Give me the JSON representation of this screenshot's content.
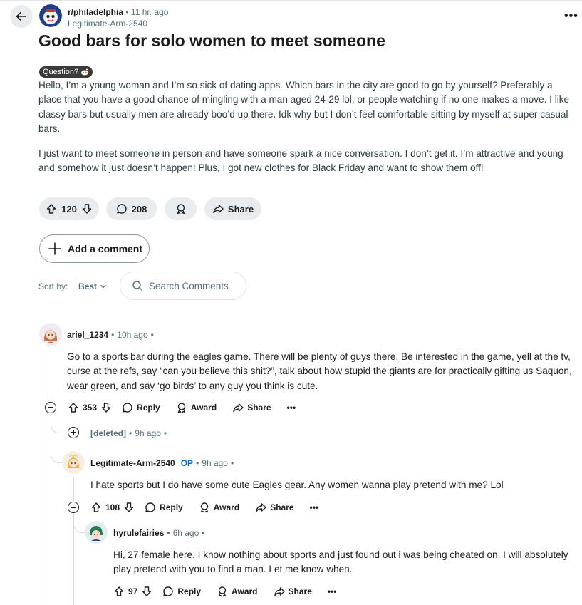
{
  "post": {
    "subreddit": "r/philadelphia",
    "time": "11 hr. ago",
    "author": "Legitimate-Arm-2540",
    "title": "Good bars for solo women to meet someone",
    "flair": "Question?",
    "paragraphs": [
      "Hello, I’m a young woman and I’m so sick of dating apps. Which bars in the city are good to go by yourself? Preferably a place that you have a good chance of mingling with a man aged 24-29 lol, or people watching if no one makes a move. I like classy bars but usually men are already boo’d up there. Idk why but I don’t feel comfortable sitting by myself at super casual bars.",
      "I just want to meet someone in person and have someone spark a nice conversation. I don’t get it. I’m attractive and young and somehow it just doesn’t happen! Plus, I got new clothes for Black Friday and want to show them off!"
    ],
    "votes": "120",
    "comments": "208",
    "share_label": "Share"
  },
  "add_comment_label": "Add a comment",
  "sort": {
    "label": "Sort by:",
    "value": "Best"
  },
  "search": {
    "placeholder": "Search Comments"
  },
  "comments": [
    {
      "author": "ariel_1234",
      "time": "10h ago",
      "text": "Go to a sports bar during the eagles game. There will be plenty of guys there. Be interested in the game, yell at the tv, curse at the refs, say “can you believe this shit?”, talk about how stupid the giants are for practically gifting us Saquon, wear green, and say ‘go birds’ to any guy you think is cute.",
      "votes": "353"
    },
    {
      "author": "[deleted]",
      "time": "9h ago"
    },
    {
      "author": "Legitimate-Arm-2540",
      "op_label": "OP",
      "time": "9h ago",
      "text": "I hate sports but I do have some cute Eagles gear. Any women wanna play pretend with me? Lol",
      "votes": "108"
    },
    {
      "author": "hyrulefairies",
      "time": "6h ago",
      "text": "Hi, 27 female here. I know nothing about sports and just found out i was being cheated on. I will absolutely play pretend with you to find a man. Let me know when.",
      "votes": "97"
    }
  ],
  "actions": {
    "reply": "Reply",
    "award": "Award",
    "share": "Share"
  },
  "colors": {
    "accent_op": "#0a66c2",
    "pill_bg": "#e9ecef",
    "meta": "#576f76"
  }
}
